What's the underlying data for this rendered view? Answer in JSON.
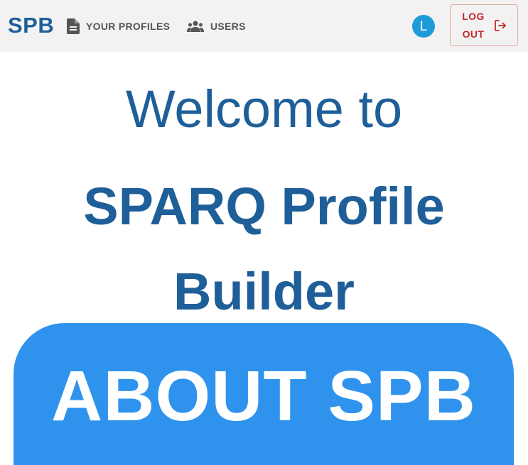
{
  "navbar": {
    "brand": "SPB",
    "links": [
      {
        "label": "YOUR PROFILES",
        "icon": "document-icon"
      },
      {
        "label": "USERS",
        "icon": "users-group-icon"
      }
    ],
    "avatar_initial": "L",
    "logout_label": "LOG OUT",
    "logout_icon": "logout-icon"
  },
  "hero": {
    "welcome": "Welcome to",
    "title_line1": "SPARQ Profile",
    "title_line2": "Builder"
  },
  "about": {
    "heading": "ABOUT SPB"
  },
  "colors": {
    "brand": "#1f5f99",
    "avatar": "#1e9bd9",
    "logout": "#c62828",
    "about_card": "#2f93ee",
    "navbar_bg": "#f2f2f2"
  }
}
